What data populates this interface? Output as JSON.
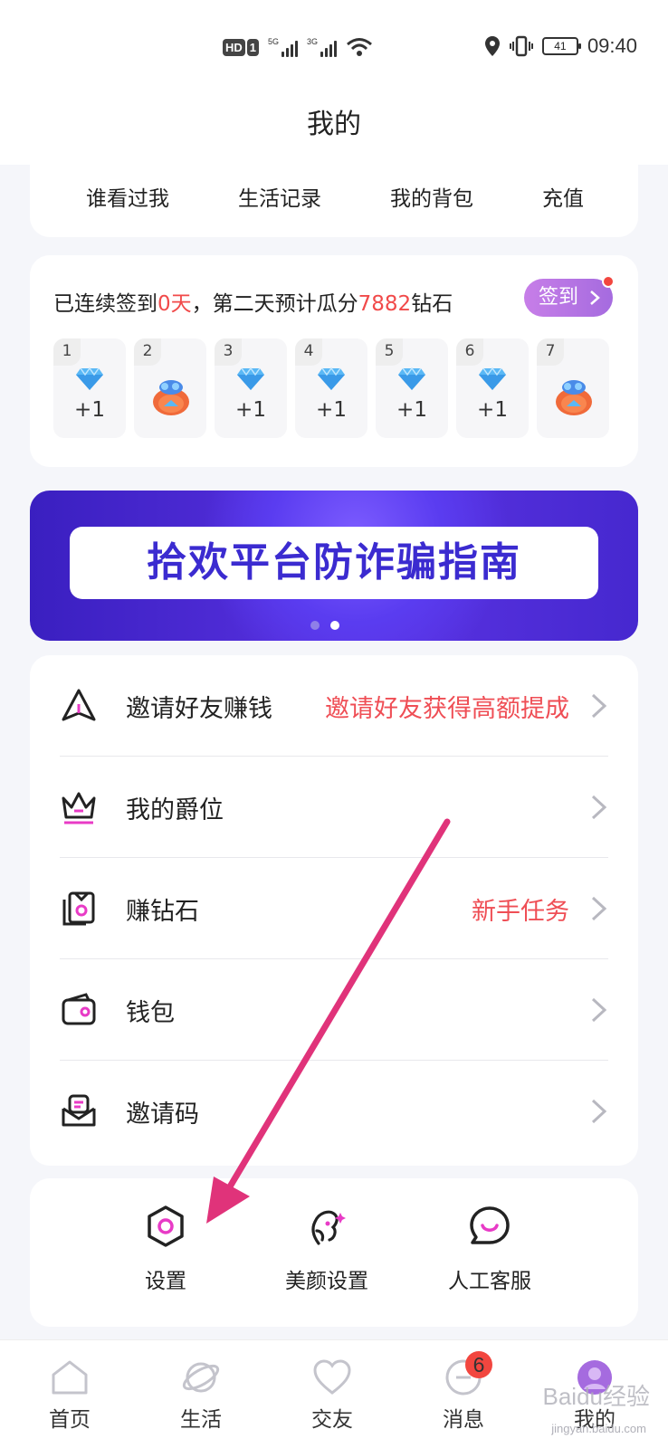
{
  "status_bar": {
    "hd_label": "HD",
    "sim1_label": "1",
    "signal1_label": "5G",
    "signal2_label": "3G",
    "battery": "41",
    "time": "09:40"
  },
  "header": {
    "title": "我的"
  },
  "quick_links": [
    {
      "label": "谁看过我"
    },
    {
      "label": "生活记录"
    },
    {
      "label": "我的背包"
    },
    {
      "label": "充值"
    }
  ],
  "sign_in": {
    "prefix": "已连续签到",
    "days_count": "0天",
    "middle": "，第二天预计瓜分",
    "diamonds": "7882",
    "suffix": "钻石",
    "button_label": "签到",
    "days": [
      {
        "num": "1",
        "reward": "+1",
        "type": "diamond"
      },
      {
        "num": "2",
        "reward": "",
        "type": "gift"
      },
      {
        "num": "3",
        "reward": "+1",
        "type": "diamond"
      },
      {
        "num": "4",
        "reward": "+1",
        "type": "diamond"
      },
      {
        "num": "5",
        "reward": "+1",
        "type": "diamond"
      },
      {
        "num": "6",
        "reward": "+1",
        "type": "diamond"
      },
      {
        "num": "7",
        "reward": "",
        "type": "gift"
      }
    ]
  },
  "banner": {
    "text": "拾欢平台防诈骗指南",
    "pages": 2,
    "active_page": 2
  },
  "menu": [
    {
      "label": "邀请好友赚钱",
      "hint": "邀请好友获得高额提成",
      "icon": "paper-plane-icon"
    },
    {
      "label": "我的爵位",
      "hint": "",
      "icon": "crown-icon"
    },
    {
      "label": "赚钻石",
      "hint": "新手任务",
      "icon": "task-card-icon"
    },
    {
      "label": "钱包",
      "hint": "",
      "icon": "wallet-icon"
    },
    {
      "label": "邀请码",
      "hint": "",
      "icon": "invite-mail-icon"
    }
  ],
  "tools": [
    {
      "label": "设置",
      "icon": "hexagon-settings-icon"
    },
    {
      "label": "美颜设置",
      "icon": "face-beauty-icon"
    },
    {
      "label": "人工客服",
      "icon": "chat-bubble-icon"
    }
  ],
  "tabbar": {
    "tabs": [
      {
        "label": "首页",
        "icon": "home-icon"
      },
      {
        "label": "生活",
        "icon": "planet-icon"
      },
      {
        "label": "交友",
        "icon": "heart-icon"
      },
      {
        "label": "消息",
        "icon": "message-icon",
        "badge": "6"
      },
      {
        "label": "我的",
        "icon": "profile-icon"
      }
    ],
    "active": "我的"
  },
  "watermark": {
    "text": "Baidu经验",
    "subtext": "jingyan.baidu.com"
  },
  "colors": {
    "accent": "#a56bdf",
    "highlight_red": "#ef4e55",
    "banner_blue": "#4a2bd8",
    "arrow_pink": "#e0337a"
  }
}
